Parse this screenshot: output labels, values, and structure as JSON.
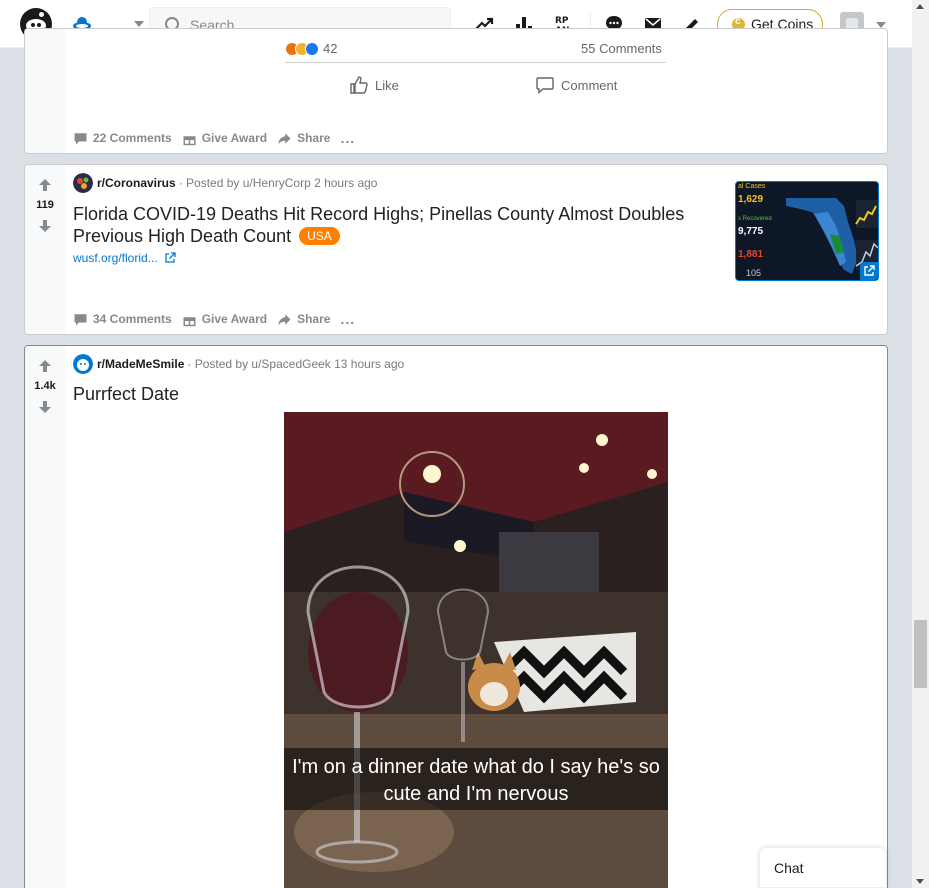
{
  "header": {
    "search_placeholder": "Search",
    "get_coins_label": "Get Coins"
  },
  "post1": {
    "reactions_count": "42",
    "fb_comments": "55 Comments",
    "like_label": "Like",
    "comment_label": "Comment",
    "actions": {
      "comments": "22 Comments",
      "award": "Give Award",
      "share": "Share",
      "more": "..."
    }
  },
  "post2": {
    "score": "119",
    "subreddit": "r/Coronavirus",
    "posted_by": "· Posted by u/HenryCorp 2 hours ago",
    "title": "Florida COVID-19 Deaths Hit Record Highs; Pinellas County Almost Doubles Previous High Death Count",
    "flair": "USA",
    "link": "wusf.org/florid...",
    "thumbnail_numbers": [
      "1,629",
      "9,775",
      "1,881",
      "105"
    ],
    "thumbnail_labels": [
      "al Cases",
      "s Recovered"
    ],
    "actions": {
      "comments": "34 Comments",
      "award": "Give Award",
      "share": "Share",
      "more": "..."
    }
  },
  "post3": {
    "score": "1.4k",
    "subreddit": "r/MadeMeSmile",
    "posted_by": "· Posted by u/SpacedGeek 13 hours ago",
    "title": "Purrfect Date",
    "image_caption": "I'm on a dinner date what do I say he's so cute and I'm nervous"
  },
  "chat": {
    "label": "Chat"
  },
  "colors": {
    "accent": "#0079d3",
    "flair": "#ff7f00",
    "coins_border": "#d8a735"
  }
}
